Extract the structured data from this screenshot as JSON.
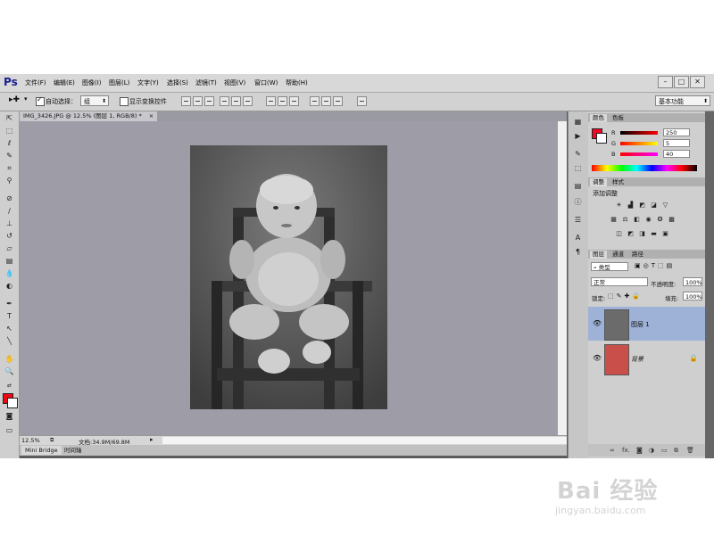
{
  "app": {
    "logo": "Ps",
    "menu": [
      "文件(F)",
      "编辑(E)",
      "图像(I)",
      "图层(L)",
      "文字(Y)",
      "选择(S)",
      "滤镜(T)",
      "视图(V)",
      "窗口(W)",
      "帮助(H)"
    ],
    "window_buttons": [
      "–",
      "□",
      "✕"
    ]
  },
  "options_bar": {
    "auto_select_label": "自动选择：",
    "auto_select_checked": true,
    "auto_select_value": "组",
    "show_transform_label": "显示变换控件",
    "show_transform_checked": false,
    "workspace": "基本功能"
  },
  "document": {
    "tab_title": "IMG_3426.JPG @ 12.5% (图层 1, RGB/8) *",
    "zoom": "12.5%",
    "doc_info": "文档:34.9M/69.8M"
  },
  "bottom_tabs": [
    "Mini Bridge",
    "时间轴"
  ],
  "color_panel": {
    "tabs": [
      "颜色",
      "色板"
    ],
    "active_tab": "颜色",
    "foreground": "#fa0528",
    "channels": [
      {
        "label": "R",
        "value": "250"
      },
      {
        "label": "G",
        "value": "5"
      },
      {
        "label": "B",
        "value": "40"
      }
    ]
  },
  "adjustments_panel": {
    "tabs": [
      "调整",
      "样式"
    ],
    "active_tab": "调整",
    "title": "添加调整"
  },
  "layers_panel": {
    "tabs": [
      "图层",
      "通道",
      "路径"
    ],
    "active_tab": "图层",
    "filter_kind": "类型",
    "blend_mode": "正常",
    "opacity_label": "不透明度:",
    "opacity_value": "100%",
    "lock_label": "锁定:",
    "fill_label": "填充:",
    "fill_value": "100%",
    "layers": [
      {
        "name": "图层 1",
        "selected": true,
        "locked": false
      },
      {
        "name": "背景",
        "selected": false,
        "locked": true
      }
    ]
  },
  "watermark": {
    "main": "Bai 经验",
    "sub": "jingyan.baidu.com"
  }
}
